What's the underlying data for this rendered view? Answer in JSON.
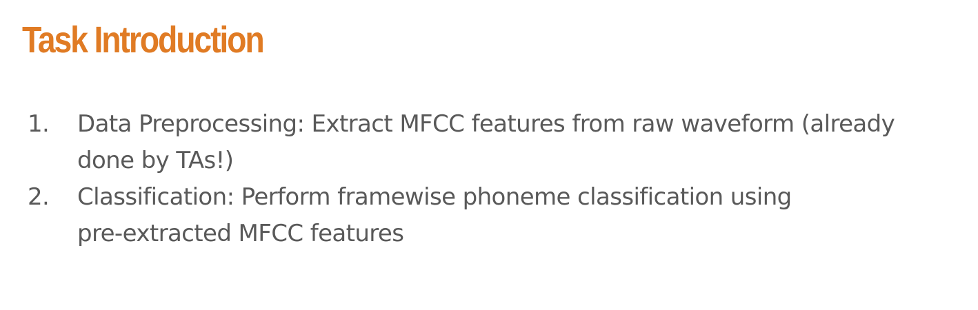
{
  "slide": {
    "title": "Task Introduction",
    "title_color": "#E07B24",
    "text_color": "#595959",
    "items": [
      {
        "number": "1.",
        "lines": [
          "Data Preprocessing: Extract MFCC features from raw waveform (already",
          "done by TAs!)"
        ]
      },
      {
        "number": "2.",
        "lines": [
          "Classification: Perform framewise phoneme classification using",
          "pre-extracted MFCC features"
        ]
      }
    ]
  }
}
